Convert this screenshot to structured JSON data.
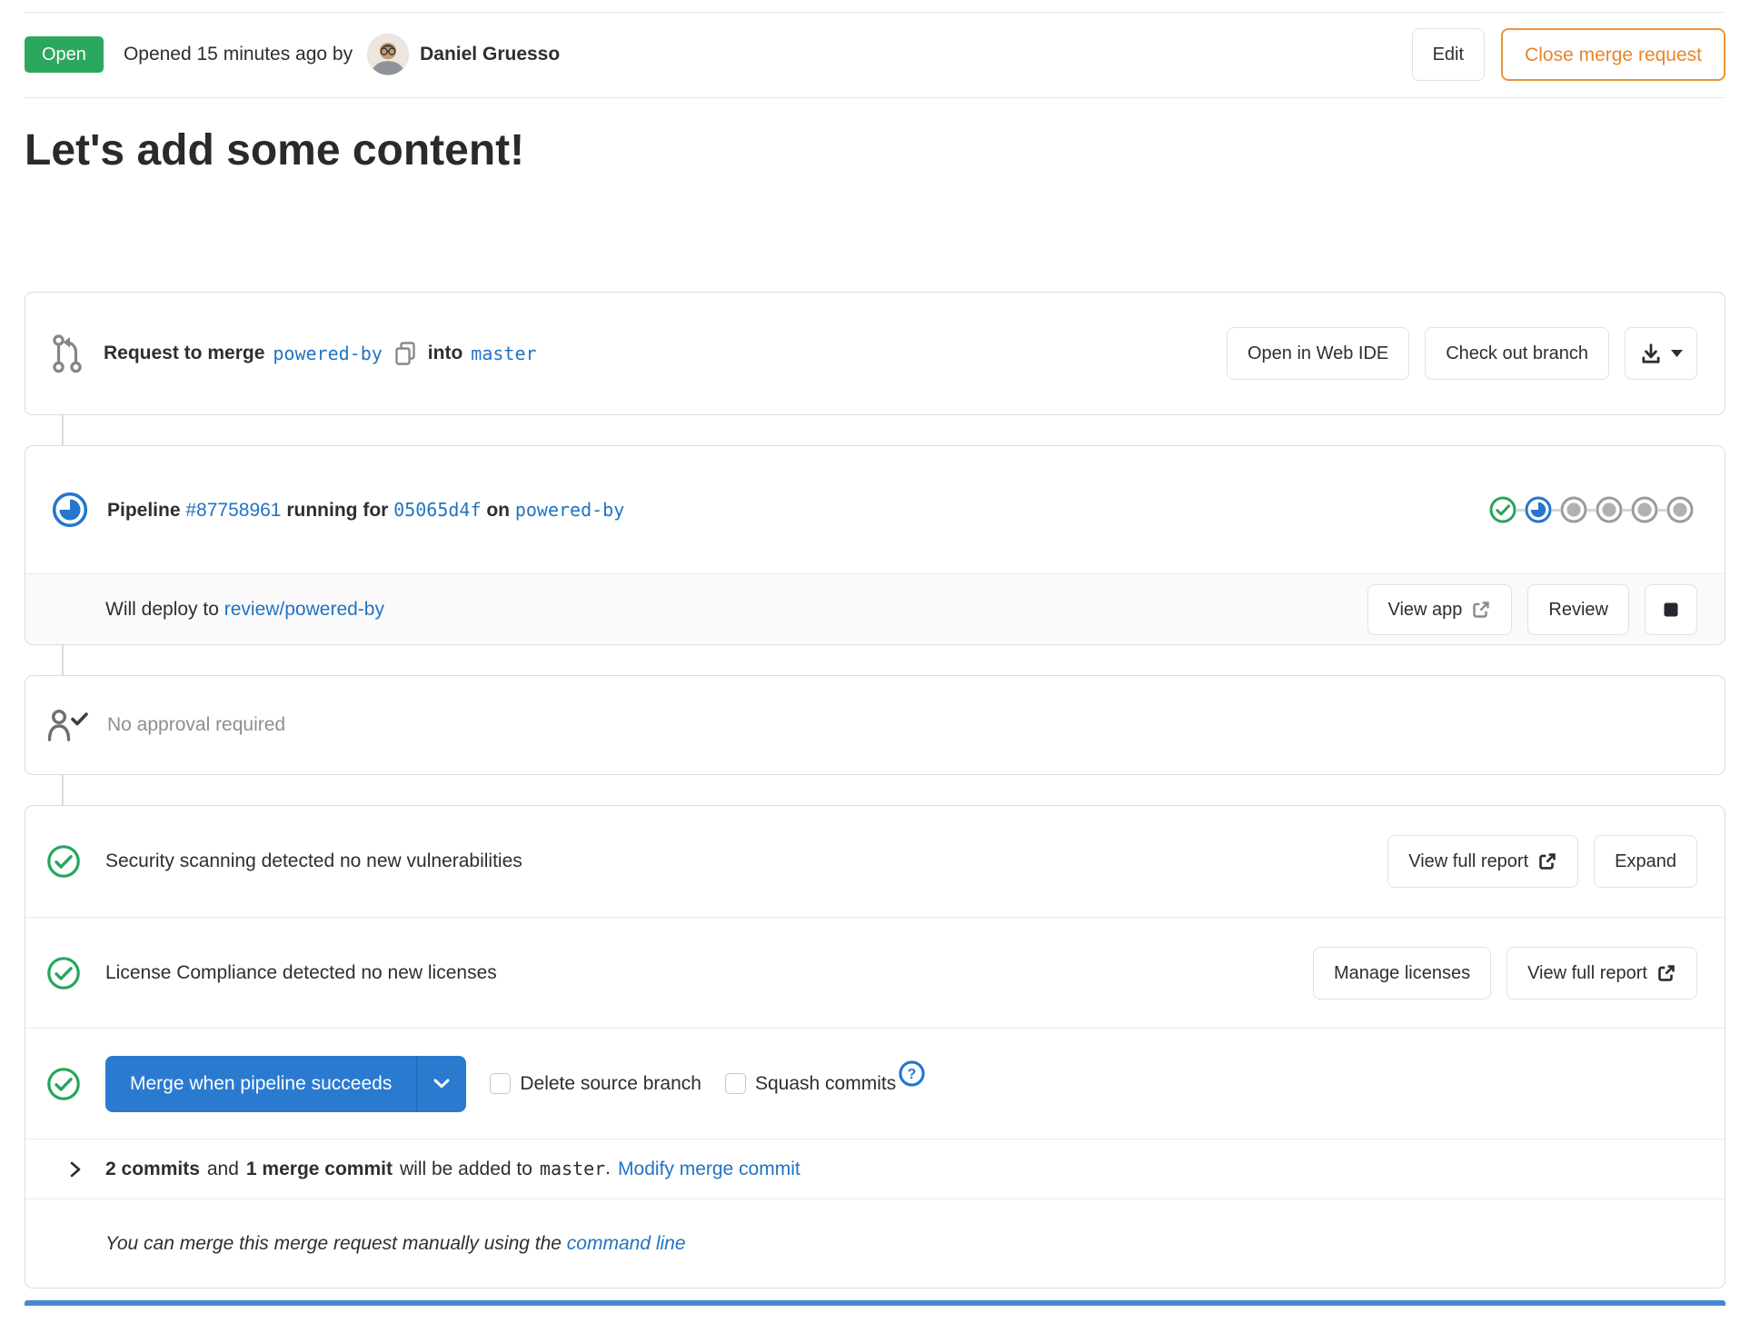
{
  "header": {
    "status_badge": "Open",
    "opened_text": "Opened 15 minutes ago by",
    "author_name": "Daniel Gruesso",
    "edit_label": "Edit",
    "close_label": "Close merge request"
  },
  "title": "Let's add some content!",
  "request": {
    "label_request": "Request to merge",
    "source_branch": "powered-by",
    "label_into": "into",
    "target_branch": "master",
    "web_ide_label": "Open in Web IDE",
    "checkout_label": "Check out branch"
  },
  "pipeline": {
    "label": "Pipeline",
    "id_link": "#87758961",
    "running_for": "running for",
    "commit_sha": "05065d4f",
    "on": "on",
    "ref_branch": "powered-by",
    "stages": [
      "success",
      "running",
      "pending",
      "pending",
      "pending",
      "pending"
    ]
  },
  "deploy": {
    "text": "Will deploy to",
    "environment_link": "review/powered-by",
    "view_app_label": "View app",
    "review_label": "Review"
  },
  "approval": {
    "message": "No approval required"
  },
  "security_row": {
    "message": "Security scanning detected no new vulnerabilities",
    "view_report_label": "View full report",
    "expand_label": "Expand"
  },
  "license_row": {
    "message": "License Compliance detected no new licenses",
    "manage_label": "Manage licenses",
    "view_report_label": "View full report"
  },
  "merge_row": {
    "merge_button_label": "Merge when pipeline succeeds",
    "delete_branch_label": "Delete source branch",
    "squash_label": "Squash commits"
  },
  "commits_row": {
    "commits_count": "2 commits",
    "and_text": "and",
    "merge_commit_count": "1 merge commit",
    "added_text": "will be added to",
    "target_branch": "master",
    "period": ".",
    "modify_link": "Modify merge commit"
  },
  "manual_row": {
    "text": "You can merge this merge request manually using the",
    "command_line_link": "command line"
  },
  "colors": {
    "open_badge_green": "#2ca85e",
    "success_green": "#26a65b",
    "running_blue": "#2477cc",
    "link_blue": "#2173c2",
    "warning_orange": "#e8862c",
    "primary_button_blue": "#2a7ad0"
  }
}
